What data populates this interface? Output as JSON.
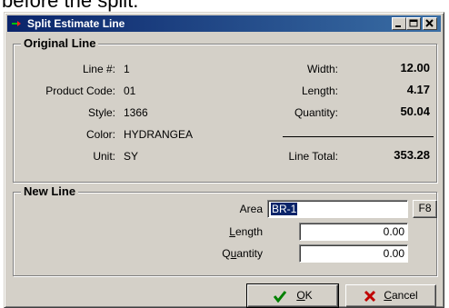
{
  "background_text": "before the split.",
  "window": {
    "title": "Split Estimate Line",
    "controls": {
      "minimize": "_",
      "maximize": "□",
      "close": "x"
    }
  },
  "original_line": {
    "group_label": "Original Line",
    "line_no_label": "Line #:",
    "line_no": "1",
    "product_code_label": "Product Code:",
    "product_code": "01",
    "style_label": "Style:",
    "style": "1366",
    "color_label": "Color:",
    "color": "HYDRANGEA",
    "unit_label": "Unit:",
    "unit": "SY",
    "width_label": "Width:",
    "width": "12.00",
    "length_label": "Length:",
    "length": "4.17",
    "quantity_label": "Quantity:",
    "quantity": "50.04",
    "line_total_label": "Line Total:",
    "line_total": "353.28"
  },
  "new_line": {
    "group_label": "New Line",
    "area_label": "Area",
    "area_value": "BR-1",
    "f8_label": "F8",
    "length_label_pre": "",
    "length_label_u": "L",
    "length_label_post": "ength",
    "length_value": "0.00",
    "quantity_label_pre": "Q",
    "quantity_label_u": "u",
    "quantity_label_post": "antity",
    "quantity_value": "0.00"
  },
  "buttons": {
    "ok_u": "O",
    "ok_rest": "K",
    "cancel_u": "C",
    "cancel_rest": "ancel"
  },
  "colors": {
    "title_bar": "#0a246a",
    "face": "#d4d0c8",
    "selection": "#0a246a",
    "ok_check": "#008000",
    "cancel_x": "#c00000"
  }
}
